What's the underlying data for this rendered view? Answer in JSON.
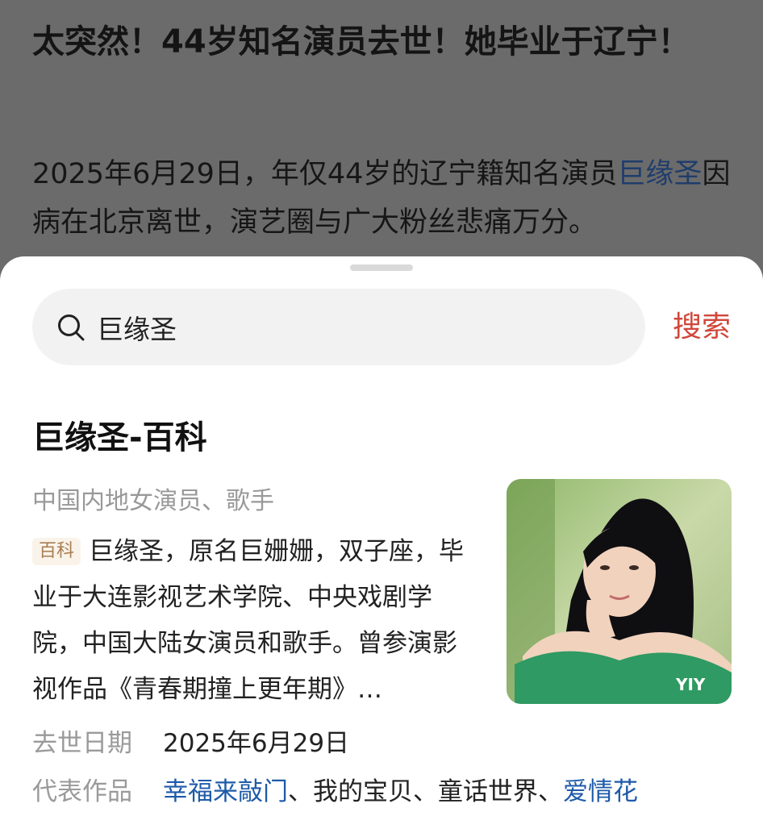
{
  "article": {
    "title": "太突然！44岁知名演员去世！她毕业于辽宁！",
    "body_prefix": " 2025年6月29日，年仅44岁的辽宁籍知名演员",
    "body_link": "巨缘圣",
    "body_suffix": "因病在北京离世，演艺圈与广大粉丝悲痛万分。"
  },
  "search": {
    "icon": "search-icon",
    "value": "巨缘圣",
    "button_label": "搜索"
  },
  "card": {
    "title": "巨缘圣-百科",
    "subtitle": "中国内地女演员、歌手",
    "badge": "百科",
    "summary": "巨缘圣，原名巨姗姗，双子座，毕业于大连影视艺术学院、中央戏剧学院，中国大陆女演员和歌手。曾参演影视作品《青春期撞上更年期》…",
    "info": {
      "death_label": "去世日期",
      "death_value": "2025年6月29日",
      "works_label": "代表作品",
      "works": [
        {
          "text": "幸福来敲门",
          "link": true
        },
        {
          "text": "、",
          "link": false
        },
        {
          "text": "我的宝贝",
          "link": false
        },
        {
          "text": "、",
          "link": false
        },
        {
          "text": "童话世界",
          "link": false
        },
        {
          "text": "、",
          "link": false
        },
        {
          "text": "爱情花",
          "link": true
        }
      ]
    }
  },
  "colors": {
    "accent": "#d0473a",
    "link": "#1e5aa8",
    "overlay": "#6b6b6b"
  }
}
